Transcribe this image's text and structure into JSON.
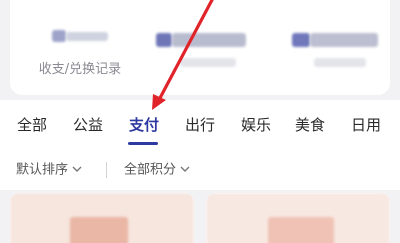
{
  "records": {
    "exchange_label": "收支/兑换记录"
  },
  "category_tabs": [
    {
      "label": "全部"
    },
    {
      "label": "公益"
    },
    {
      "label": "支付"
    },
    {
      "label": "出行"
    },
    {
      "label": "娱乐"
    },
    {
      "label": "美食"
    },
    {
      "label": "日用"
    }
  ],
  "active_tab": "支付",
  "filters": {
    "sort_label": "默认排序",
    "points_label": "全部积分"
  },
  "colors": {
    "accent": "#2e3aa0",
    "annotation_arrow": "#e0242a"
  }
}
